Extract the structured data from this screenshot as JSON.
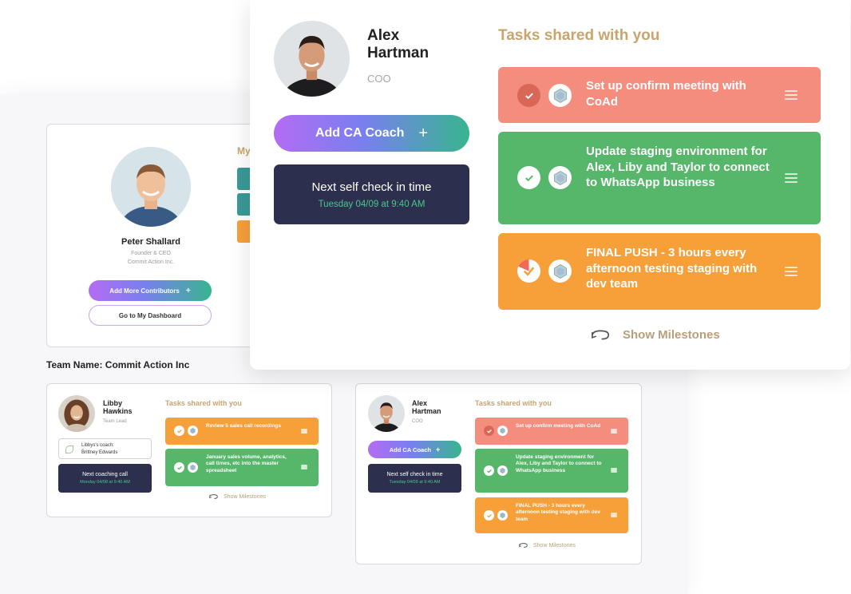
{
  "peter": {
    "name": "Peter Shallard",
    "role": "Founder & CEO",
    "company": "Commit Action Inc.",
    "heading_partial": "My",
    "add_contributors": "Add More Contributors",
    "add_plus": "+",
    "dashboard": "Go to My Dashboard"
  },
  "team": {
    "label": "Team Name: Commit Action Inc"
  },
  "libby": {
    "first": "Libby",
    "last": "Hawkins",
    "role": "Team Lead",
    "coach_label": "Libbys's coach:",
    "coach_name": "Brittney Edwards",
    "next_call": "Next coaching call",
    "next_call_time": "Monday 04/08 at 9:40 AM",
    "tasks_title": "Tasks shared with you",
    "tasks": [
      {
        "text": "Review 5 sales call recordings",
        "color": "#f7a03a"
      },
      {
        "text": "January sales volume, analytics, call times, etc into the master spreadsheet",
        "color": "#56b669"
      }
    ],
    "milestones": "Show Milestones"
  },
  "alex_small": {
    "first": "Alex",
    "last": "Hartman",
    "role": "COO",
    "add_coach": "Add CA Coach",
    "add_plus": "+",
    "next_check": "Next self check in time",
    "next_check_time": "Tuesday 04/09 at 9:40 AM",
    "tasks_title": "Tasks shared with you",
    "tasks": [
      {
        "text": "Set up confirm meeting with CoAd",
        "color": "#f58d7f"
      },
      {
        "text": "Update staging environment for Alex, Liby and Taylor to connect to WhatsApp business",
        "color": "#56b669"
      },
      {
        "text": "FINAL PUSH - 3 hours every afternoon testing staging with dev team",
        "color": "#f7a03a"
      }
    ],
    "milestones": "Show Milestones"
  },
  "alex": {
    "first": "Alex",
    "last": "Hartman",
    "role": "COO",
    "add_coach": "Add CA Coach",
    "add_plus": "+",
    "next_check": "Next self check in time",
    "next_check_time": "Tuesday 04/09 at 9:40 AM",
    "tasks_title": "Tasks shared with you",
    "tasks": [
      {
        "text": "Set up confirm meeting with CoAd",
        "color": "#f58d7f"
      },
      {
        "text": "Update staging environment for Alex, Liby and Taylor to connect to WhatsApp business",
        "color": "#56b669"
      },
      {
        "text": "FINAL PUSH - 3 hours every afternoon testing staging with dev team",
        "color": "#f7a03a"
      }
    ],
    "milestones": "Show Milestones"
  },
  "colors": {
    "salmon": "#f58d7f",
    "green": "#56b669",
    "orange": "#f7a03a",
    "navy": "#2d2f4e",
    "gold": "#c8a46e",
    "teal": "#3a9a98"
  },
  "icons": [
    "check-icon",
    "hexagon-avatar-icon",
    "hamburger-icon",
    "refresh-icon",
    "plus-icon",
    "leaf-icon"
  ]
}
